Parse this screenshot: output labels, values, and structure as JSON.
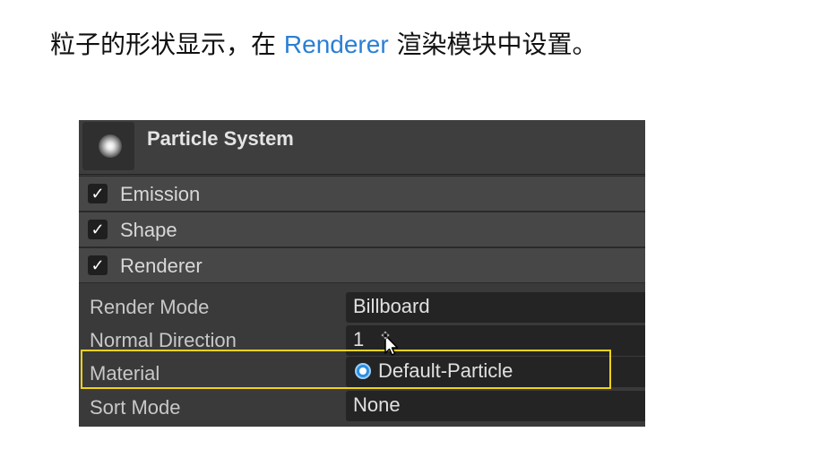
{
  "caption": {
    "before": "粒子的形状显示，在 ",
    "highlight": "Renderer",
    "after": " 渲染模块中设置。"
  },
  "inspector": {
    "title": "Particle System",
    "title_icon": "particle-system-icon",
    "modules": [
      {
        "label": "Emission",
        "checked": true
      },
      {
        "label": "Shape",
        "checked": true
      },
      {
        "label": "Renderer",
        "checked": true
      }
    ],
    "check_glyph": "✓",
    "properties": {
      "render_mode": {
        "label": "Render Mode",
        "value": "Billboard"
      },
      "normal_direction": {
        "label": "Normal Direction",
        "value": "1"
      },
      "material": {
        "label": "Material",
        "value": "Default-Particle",
        "icon": "material-icon"
      },
      "sort_mode": {
        "label": "Sort Mode",
        "value": "None"
      }
    }
  },
  "colors": {
    "highlight_text": "#2a7fd4",
    "highlight_box": "#f2d21a",
    "panel_bg": "#3a3a3a"
  }
}
